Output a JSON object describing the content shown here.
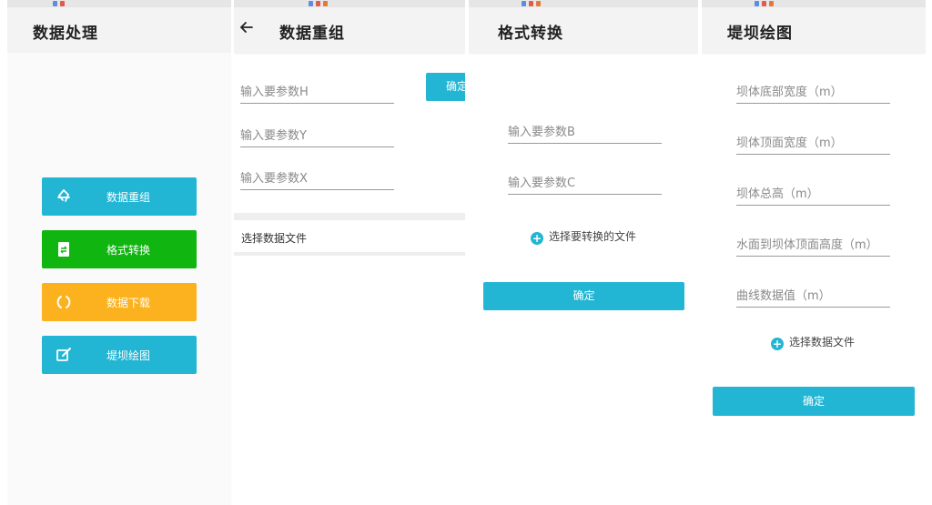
{
  "colors": {
    "teal": "#22b6d4",
    "green": "#10b510",
    "orange": "#fcb21e",
    "appbar_bg": "#f3f3f3"
  },
  "screen1": {
    "title": "数据处理",
    "menu": [
      {
        "label": "数据重组",
        "icon": "recycle-icon",
        "color": "#22b6d4"
      },
      {
        "label": "格式转换",
        "icon": "file-transfer-icon",
        "color": "#10b510"
      },
      {
        "label": "数据下载",
        "icon": "refresh-icon",
        "color": "#fcb21e"
      },
      {
        "label": "堤坝绘图",
        "icon": "edit-icon",
        "color": "#22b6d4"
      }
    ]
  },
  "screen2": {
    "title": "数据重组",
    "confirm_label": "确定",
    "fields": [
      {
        "placeholder": "输入要参数H"
      },
      {
        "placeholder": "输入要参数Y"
      },
      {
        "placeholder": "输入要参数X"
      }
    ],
    "choose_file": "选择数据文件"
  },
  "screen3": {
    "title": "格式转换",
    "fields": [
      {
        "placeholder": "输入要参数B"
      },
      {
        "placeholder": "输入要参数C"
      }
    ],
    "choose_file": "选择要转换的文件",
    "confirm_label": "确定"
  },
  "screen4": {
    "title": "堤坝绘图",
    "fields": [
      {
        "placeholder": "坝体底部宽度（m）"
      },
      {
        "placeholder": "坝体顶面宽度（m）"
      },
      {
        "placeholder": "坝体总高（m）"
      },
      {
        "placeholder": "水面到坝体顶面高度（m）"
      },
      {
        "placeholder": "曲线数据值（m）"
      }
    ],
    "choose_file": "选择数据文件",
    "confirm_label": "确定"
  }
}
